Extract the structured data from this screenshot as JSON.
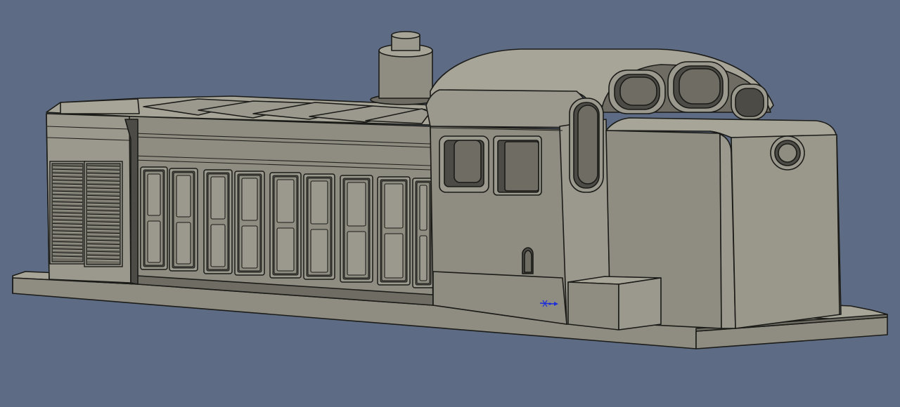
{
  "viewport": {
    "background_color": "#5d6c84",
    "render_mode": "shaded-with-edges"
  },
  "model": {
    "name": "locomotive-body",
    "face_colors": {
      "side": "#8f8c81",
      "side_light": "#9b988d",
      "top": "#a7a498",
      "shadow": "#6e6c63",
      "dark": "#4d4b45",
      "front": "#9a978b",
      "edge": "#1b1b18"
    },
    "louver_columns": 2,
    "door_panels": 9,
    "cab_windows": 2,
    "roof_windows": 3
  },
  "triad": {
    "icon": "axis-triad-icon",
    "color": "#1f2fd8"
  }
}
